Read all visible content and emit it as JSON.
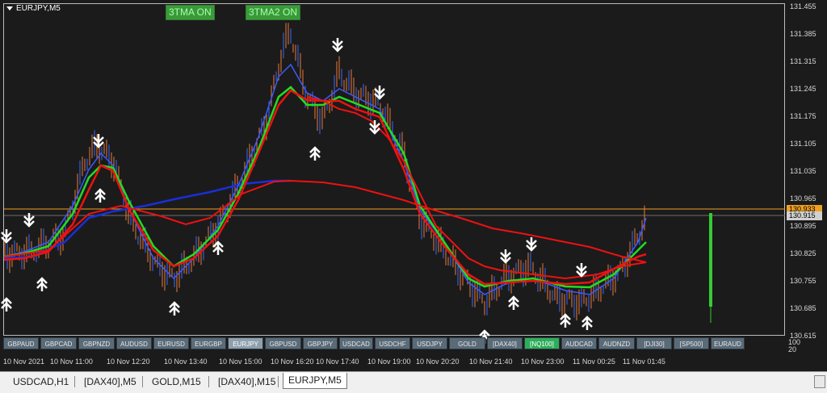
{
  "chart": {
    "symbol_label": "EURJPY,M5",
    "indicator_buttons": [
      "3TMA ON",
      "3TMA2 ON"
    ],
    "price_labels": [
      "131.455",
      "131.385",
      "131.315",
      "131.245",
      "131.175",
      "131.105",
      "131.035",
      "130.965",
      "130.895",
      "130.825",
      "130.755",
      "130.685",
      "130.615"
    ],
    "current_price_tags": [
      "130.933",
      "130.915"
    ],
    "time_labels": [
      "10 Nov 2021",
      "10 Nov 11:00",
      "10 Nov 12:20",
      "10 Nov 13:40",
      "10 Nov 15:00",
      "10 Nov 16:20",
      "10 Nov 17:40",
      "10 Nov 19:00",
      "10 Nov 20:20",
      "10 Nov 21:40",
      "10 Nov 23:00",
      "11 Nov 00:25",
      "11 Nov 01:45"
    ],
    "sub_axis_labels": [
      "100",
      "20"
    ],
    "symbol_buttons": [
      "GBPAUD",
      "GBPCAD",
      "GBPNZD",
      "AUDUSD",
      "EURUSD",
      "EURGBP",
      "EURJPY",
      "GBPUSD",
      "GBPJPY",
      "USDCAD",
      "USDCHF",
      "USDJPY",
      "GOLD",
      "[DAX40]",
      "[NQ100]",
      "AUDCAD",
      "AUDNZD",
      "[DJI30]",
      "[SP500]",
      "EURAUD"
    ],
    "active_symbol": "EURJPY",
    "highlight_symbol": "[NQ100]",
    "colors": {
      "background": "#1b1b1b",
      "candle": "#e87a3a",
      "tma_blue": "#1a2fd8",
      "tma_green": "#22dd22",
      "tma_red": "#ee1111",
      "price_line": "#f0a020",
      "arrow": "#ffffff"
    }
  },
  "tabs": [
    "USDCAD,H1",
    "[DAX40],M5",
    "GOLD,M15",
    "[DAX40],M15",
    "EURJPY,M5"
  ],
  "active_tab": "EURJPY,M5"
}
